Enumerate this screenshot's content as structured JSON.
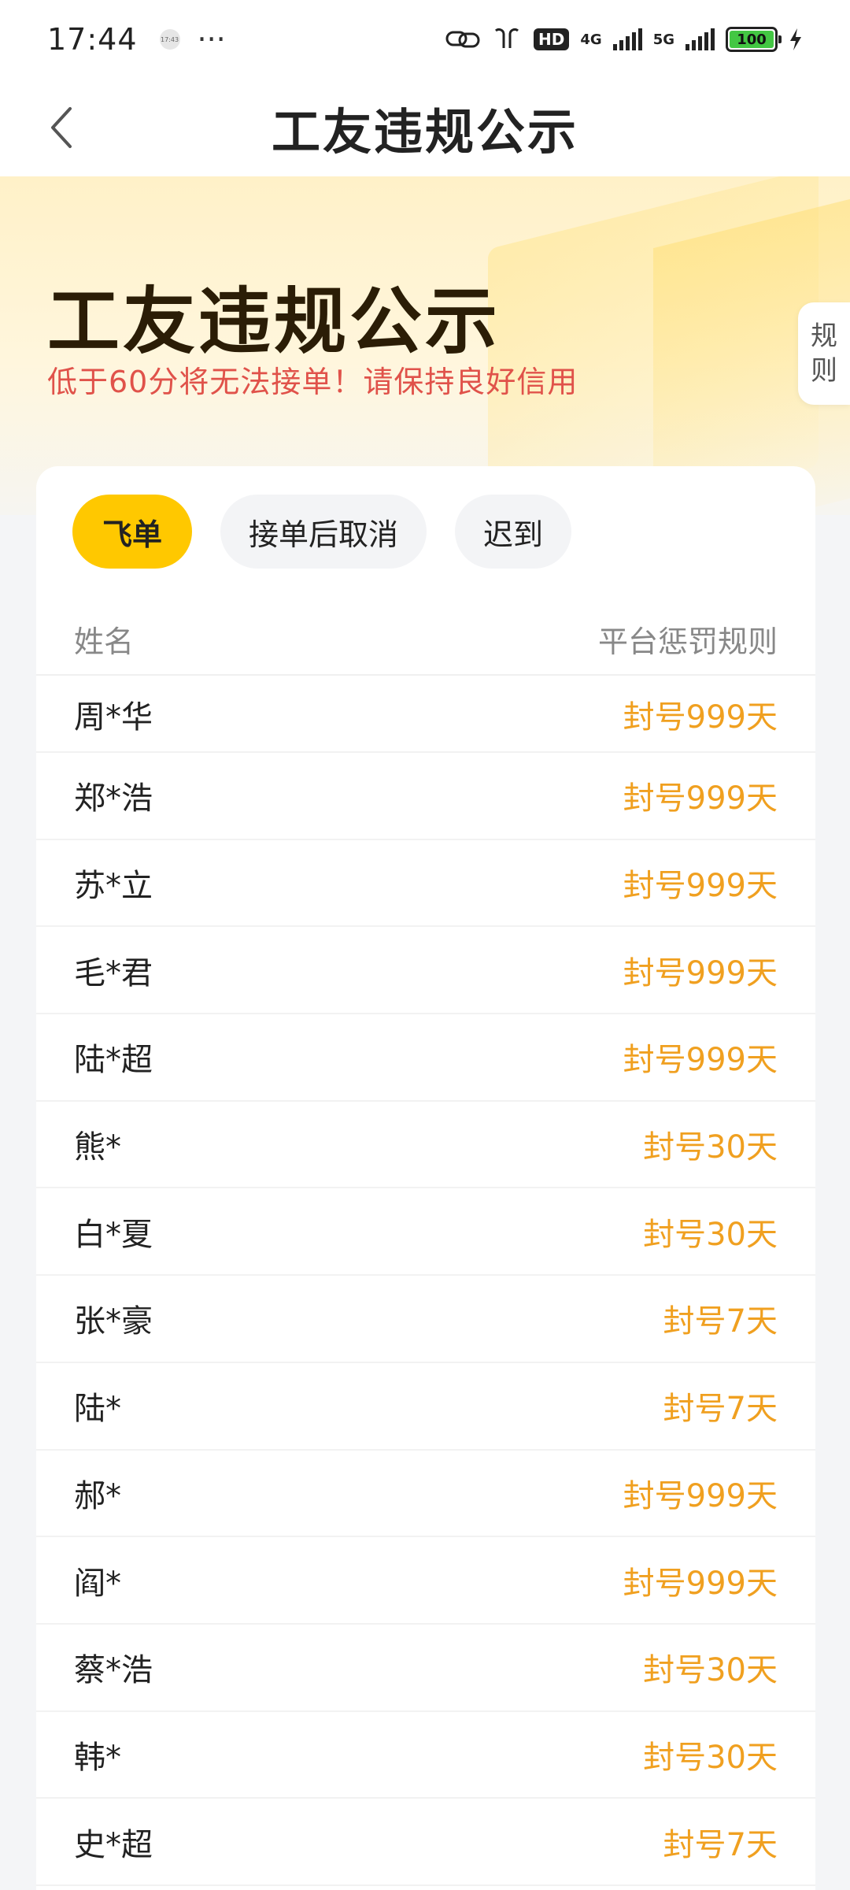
{
  "status_bar": {
    "time": "17:44",
    "mini_icon_text": "17:43",
    "more": "···",
    "hd": "HD",
    "net1": "4G",
    "net2": "5G",
    "battery": "100"
  },
  "nav": {
    "title": "工友违规公示"
  },
  "hero": {
    "title": "工友违规公示",
    "subtitle": "低于60分将无法接单！请保持良好信用",
    "rules_tab": [
      "规",
      "则"
    ]
  },
  "tabs": [
    {
      "label": "飞单",
      "active": true
    },
    {
      "label": "接单后取消",
      "active": false
    },
    {
      "label": "迟到",
      "active": false
    }
  ],
  "table": {
    "header_name": "姓名",
    "header_rule": "平台惩罚规则",
    "rows": [
      {
        "name": "周*华",
        "penalty": "封号999天"
      },
      {
        "name": "郑*浩",
        "penalty": "封号999天"
      },
      {
        "name": "苏*立",
        "penalty": "封号999天"
      },
      {
        "name": "毛*君",
        "penalty": "封号999天"
      },
      {
        "name": "陆*超",
        "penalty": "封号999天"
      },
      {
        "name": "熊*",
        "penalty": "封号30天"
      },
      {
        "name": "白*夏",
        "penalty": "封号30天"
      },
      {
        "name": "张*豪",
        "penalty": "封号7天"
      },
      {
        "name": "陆*",
        "penalty": "封号7天"
      },
      {
        "name": "郝*",
        "penalty": "封号999天"
      },
      {
        "name": "阎*",
        "penalty": "封号999天"
      },
      {
        "name": "蔡*浩",
        "penalty": "封号30天"
      },
      {
        "name": "韩*",
        "penalty": "封号30天"
      },
      {
        "name": "史*超",
        "penalty": "封号7天"
      }
    ]
  },
  "colors": {
    "accent": "#ffc800",
    "penalty": "#f0a020",
    "subtitle": "#e0524a"
  }
}
